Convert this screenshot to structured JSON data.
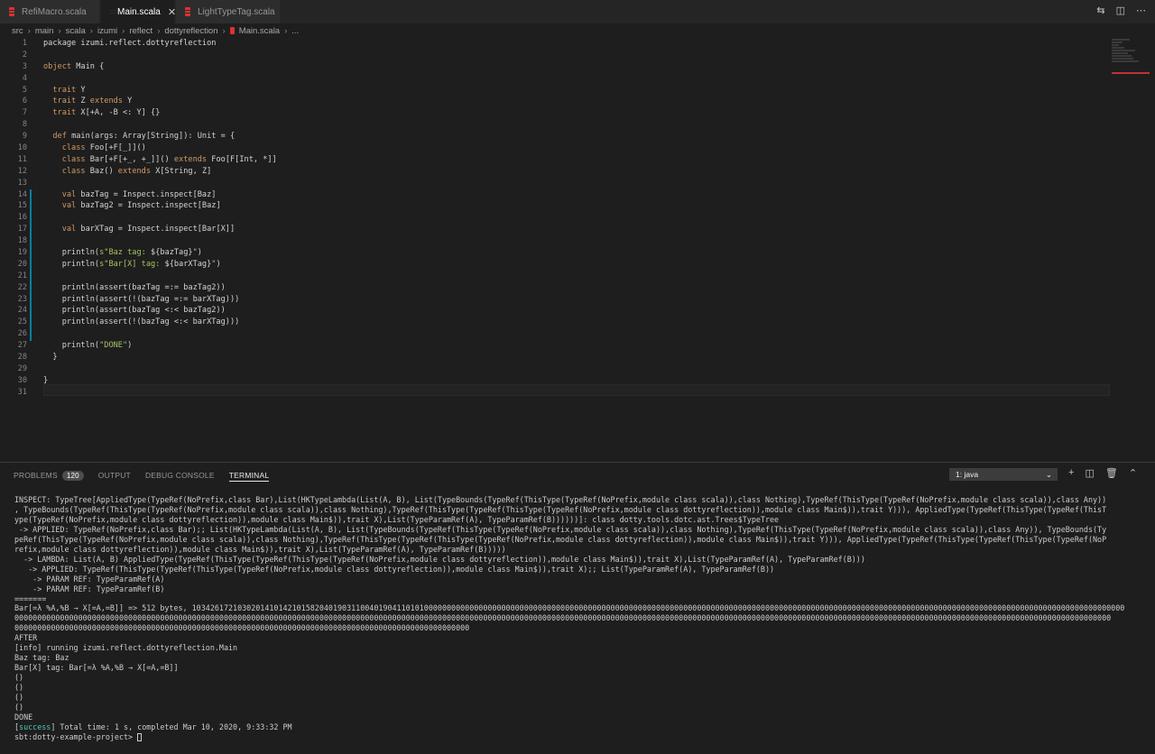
{
  "tabs": [
    {
      "label": "RefiMacro.scala"
    },
    {
      "label": "Main.scala"
    },
    {
      "label": "LightTypeTag.scala"
    }
  ],
  "breadcrumb": [
    "src",
    "main",
    "scala",
    "izumi",
    "reflect",
    "dottyreflection",
    "Main.scala",
    "..."
  ],
  "editor": {
    "line_numbers": [
      "1",
      "2",
      "3",
      "4",
      "5",
      "6",
      "7",
      "8",
      "9",
      "10",
      "11",
      "12",
      "13",
      "14",
      "15",
      "16",
      "17",
      "18",
      "19",
      "20",
      "21",
      "22",
      "23",
      "24",
      "25",
      "26",
      "27",
      "28",
      "29",
      "30",
      "31"
    ],
    "lines": [
      [
        [
          "",
          "package izumi.reflect.dottyreflection"
        ]
      ],
      [],
      [
        [
          "kw",
          "object "
        ],
        [
          "",
          "Main {"
        ]
      ],
      [],
      [
        [
          "",
          "  "
        ],
        [
          "kw",
          "trait "
        ],
        [
          "",
          "Y"
        ]
      ],
      [
        [
          "",
          "  "
        ],
        [
          "kw",
          "trait "
        ],
        [
          "",
          "Z "
        ],
        [
          "kw",
          "extends "
        ],
        [
          "",
          "Y"
        ]
      ],
      [
        [
          "",
          "  "
        ],
        [
          "kw",
          "trait "
        ],
        [
          "",
          "X[+A, -B <: Y] {}"
        ]
      ],
      [],
      [
        [
          "",
          "  "
        ],
        [
          "kw",
          "def "
        ],
        [
          "",
          "main(args: Array[String]): Unit = {"
        ]
      ],
      [
        [
          "",
          "    "
        ],
        [
          "kw",
          "class "
        ],
        [
          "",
          "Foo[+F[_]]()"
        ]
      ],
      [
        [
          "",
          "    "
        ],
        [
          "kw",
          "class "
        ],
        [
          "",
          "Bar[+F[+_, +_]]() "
        ],
        [
          "kw",
          "extends "
        ],
        [
          "",
          "Foo[F[Int, *]]"
        ]
      ],
      [
        [
          "",
          "    "
        ],
        [
          "kw",
          "class "
        ],
        [
          "",
          "Baz() "
        ],
        [
          "kw",
          "extends "
        ],
        [
          "",
          "X[String, Z]"
        ]
      ],
      [],
      [
        [
          "",
          "    "
        ],
        [
          "kw",
          "val "
        ],
        [
          "",
          "bazTag = Inspect.inspect[Baz]"
        ]
      ],
      [
        [
          "",
          "    "
        ],
        [
          "kw",
          "val "
        ],
        [
          "",
          "bazTag2 = Inspect.inspect[Baz]"
        ]
      ],
      [],
      [
        [
          "",
          "    "
        ],
        [
          "kw",
          "val "
        ],
        [
          "",
          "barXTag = Inspect.inspect[Bar[X]]"
        ]
      ],
      [],
      [
        [
          "",
          "    println("
        ],
        [
          "str",
          "s\"Baz tag: "
        ],
        [
          "",
          "${bazTag}"
        ],
        [
          "str",
          "\""
        ],
        [
          "",
          ")"
        ]
      ],
      [
        [
          "",
          "    println("
        ],
        [
          "str",
          "s\"Bar[X] tag: "
        ],
        [
          "",
          "${barXTag}"
        ],
        [
          "str",
          "\""
        ],
        [
          "",
          ")"
        ]
      ],
      [],
      [
        [
          "",
          "    println(assert(bazTag =:= bazTag2))"
        ]
      ],
      [
        [
          "",
          "    println(assert(!(bazTag =:= barXTag)))"
        ]
      ],
      [
        [
          "",
          "    println(assert(bazTag <:< bazTag2))"
        ]
      ],
      [
        [
          "",
          "    println(assert(!(bazTag <:< barXTag)))"
        ]
      ],
      [],
      [
        [
          "",
          "    println("
        ],
        [
          "str",
          "\"DONE\""
        ],
        [
          "",
          ")"
        ]
      ],
      [
        [
          "",
          "  }"
        ]
      ],
      [],
      [
        [
          "",
          "}"
        ]
      ],
      []
    ]
  },
  "panel": {
    "tabs": [
      {
        "label": "PROBLEMS",
        "badge": "120"
      },
      {
        "label": "OUTPUT"
      },
      {
        "label": "DEBUG CONSOLE"
      },
      {
        "label": "TERMINAL"
      }
    ],
    "terminal_select": "1: java"
  },
  "terminal": {
    "lines": [
      "INSPECT: TypeTree[AppliedType(TypeRef(NoPrefix,class Bar),List(HKTypeLambda(List(A, B), List(TypeBounds(TypeRef(ThisType(TypeRef(NoPrefix,module class scala)),class Nothing),TypeRef(ThisType(TypeRef(NoPrefix,module class scala)),class Any))",
      ", TypeBounds(TypeRef(ThisType(TypeRef(NoPrefix,module class scala)),class Nothing),TypeRef(ThisType(TypeRef(ThisType(TypeRef(NoPrefix,module class dottyreflection)),module class Main$)),trait Y))), AppliedType(TypeRef(ThisType(TypeRef(ThisT",
      "ype(TypeRef(NoPrefix,module class dottyreflection)),module class Main$)),trait X),List(TypeParamRef(A), TypeParamRef(B))))))]: class dotty.tools.dotc.ast.Trees$TypeTree",
      " -> APPLIED: TypeRef(NoPrefix,class Bar);; List(HKTypeLambda(List(A, B), List(TypeBounds(TypeRef(ThisType(TypeRef(NoPrefix,module class scala)),class Nothing),TypeRef(ThisType(TypeRef(NoPrefix,module class scala)),class Any)), TypeBounds(Ty",
      "peRef(ThisType(TypeRef(NoPrefix,module class scala)),class Nothing),TypeRef(ThisType(TypeRef(ThisType(TypeRef(NoPrefix,module class dottyreflection)),module class Main$)),trait Y))), AppliedType(TypeRef(ThisType(TypeRef(ThisType(TypeRef(NoP",
      "refix,module class dottyreflection)),module class Main$)),trait X),List(TypeParamRef(A), TypeParamRef(B)))))",
      "  -> LAMBDA: List(A, B) AppliedType(TypeRef(ThisType(TypeRef(ThisType(TypeRef(NoPrefix,module class dottyreflection)),module class Main$)),trait X),List(TypeParamRef(A), TypeParamRef(B)))",
      "   -> APPLIED: TypeRef(ThisType(TypeRef(ThisType(TypeRef(NoPrefix,module class dottyreflection)),module class Main$)),trait X);; List(TypeParamRef(A), TypeParamRef(B))",
      "    -> PARAM REF: TypeParamRef(A)",
      "    -> PARAM REF: TypeParamRef(B)",
      "=======",
      "Bar[=λ %A,%B → X[=A,=B]] => 512 bytes, 1034261721030201410142101582040190311004019041101010000000000000000000000000000000000000000000000000000000000000000000000000000000000000000000000000000000000000000000000000000000000000000000000000000000000",
      "0000000000000000000000000000000000000000000000000000000000000000000000000000000000000000000000000000000000000000000000000000000000000000000000000000000000000000000000000000000000000000000000000000000000000000000000000000000000000000000000000",
      "0000000000000000000000000000000000000000000000000000000000000000000000000000000000000000000000000000",
      "AFTER",
      "[info] running izumi.reflect.dottyreflection.Main",
      "Baz tag: Baz",
      "Bar[X] tag: Bar[=λ %A,%B → X[=A,=B]]",
      "()",
      "()",
      "()",
      "()",
      "DONE"
    ],
    "success_tag": "success",
    "success_text": " Total time: 1 s, completed Mar 10, 2020, 9:33:32 PM",
    "prompt": "sbt:dotty-example-project> "
  }
}
